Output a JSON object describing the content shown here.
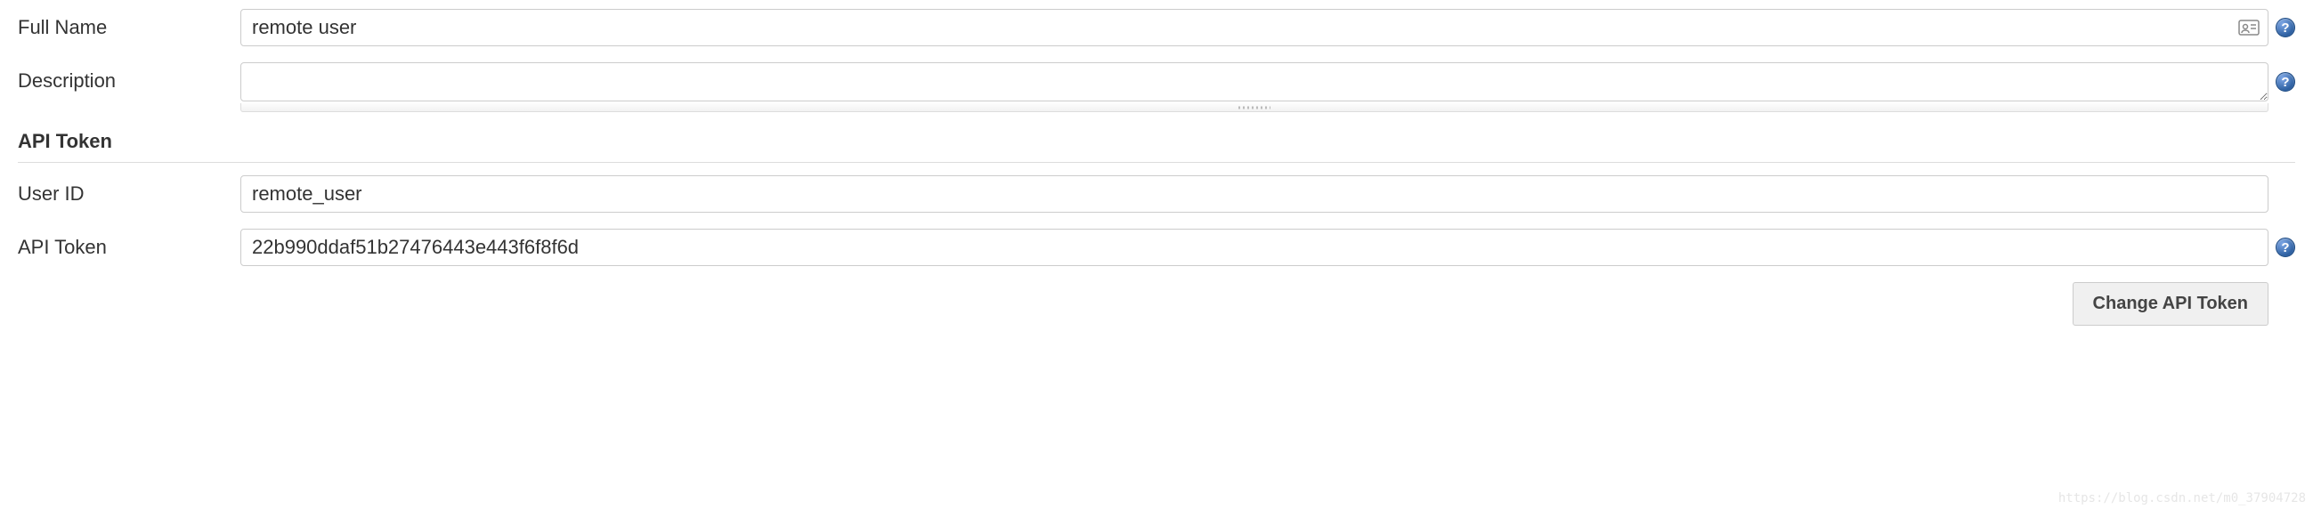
{
  "labels": {
    "full_name": "Full Name",
    "description": "Description",
    "user_id": "User ID",
    "api_token_field": "API Token"
  },
  "values": {
    "full_name": "remote user",
    "description": "",
    "user_id": "remote_user",
    "api_token": "22b990ddaf51b27476443e443f6f8f6d"
  },
  "sections": {
    "api_token": "API Token"
  },
  "buttons": {
    "change_api_token": "Change API Token"
  },
  "help_glyph": "?",
  "watermark": "https://blog.csdn.net/m0_37904728"
}
